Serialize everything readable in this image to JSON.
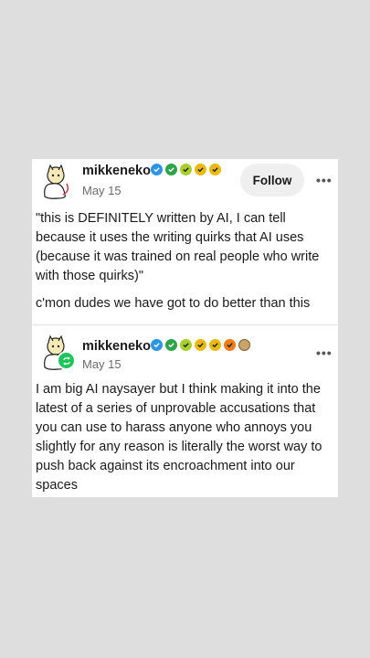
{
  "colors": {
    "reblog_green": "#1fc55a",
    "badge_blue": "#2b95e6",
    "badge_green": "#2ea34a",
    "badge_lime": "#a7cf2e",
    "badge_yellow": "#e8b90f",
    "badge_orange": "#ee7d1a"
  },
  "post1": {
    "username": "mikkeneko",
    "date": "May 15",
    "follow_label": "Follow",
    "more_label": "•••",
    "badges": [
      "verified-blue-badge",
      "green-badge",
      "lime-badge",
      "yellow-badge",
      "yellow-badge"
    ],
    "paragraph1": "\"this is DEFINITELY written by AI, I can tell because it uses the writing quirks that AI uses (because it was trained on real people who write with those quirks)\"",
    "paragraph2": "c'mon dudes we have got to do better than this"
  },
  "post2": {
    "username": "mikkeneko",
    "date": "May 15",
    "more_label": "•••",
    "badges": [
      "verified-blue-badge",
      "green-badge",
      "lime-badge",
      "yellow-badge",
      "yellow-badge",
      "orange-badge",
      "cookie-badge"
    ],
    "body": "I am big AI naysayer but I think making it into the latest of a series of unprovable accusations that you can use to harass anyone who annoys you slightly for any reason is literally the worst way to push back against its encroachment into our spaces"
  }
}
